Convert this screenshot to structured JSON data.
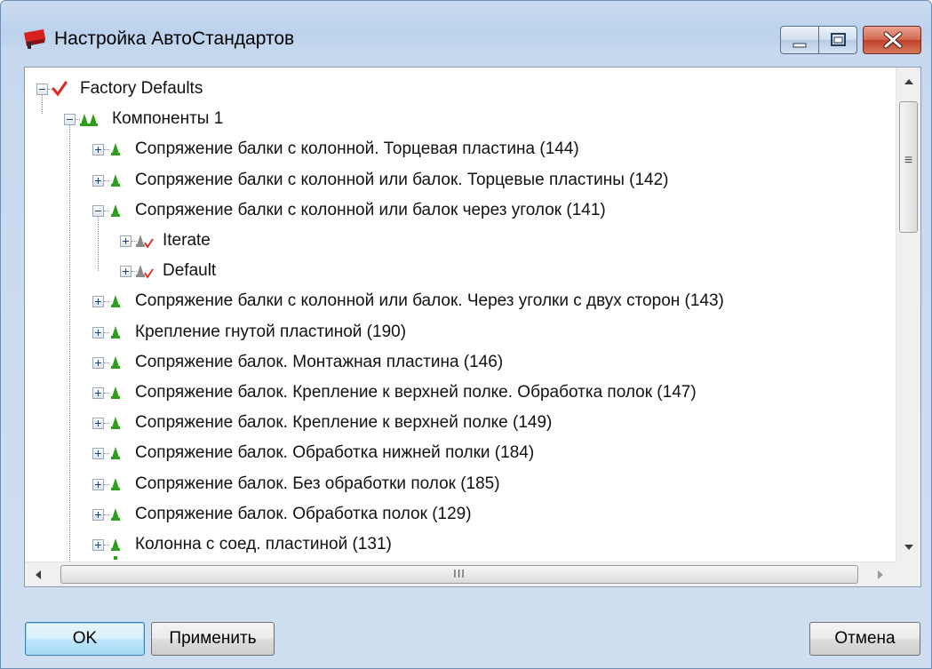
{
  "window": {
    "title": "Настройка АвтоСтандартов"
  },
  "titlebar_buttons": [
    "minimize-button",
    "maximize-button",
    "close-button"
  ],
  "tree": {
    "root": {
      "label": "Factory Defaults",
      "expanded": true
    },
    "group": {
      "label": "Компоненты 1",
      "expanded": true
    },
    "items": [
      {
        "label": "Сопряжение балки с колонной. Торцевая пластина (144)",
        "expanded": false,
        "level": 2
      },
      {
        "label": "Сопряжение балки с колонной или балок. Торцевые пластины (142)",
        "expanded": false,
        "level": 2
      },
      {
        "label": "Сопряжение балки с колонной или балок через уголок (141)",
        "expanded": true,
        "level": 2
      },
      {
        "label": "Iterate",
        "expanded": false,
        "level": 3
      },
      {
        "label": "Default",
        "expanded": false,
        "level": 3
      },
      {
        "label": "Сопряжение балки с колонной или балок. Через уголки с двух сторон (143)",
        "expanded": false,
        "level": 2
      },
      {
        "label": "Крепление гнутой пластиной (190)",
        "expanded": false,
        "level": 2
      },
      {
        "label": "Сопряжение балок. Монтажная пластина (146)",
        "expanded": false,
        "level": 2
      },
      {
        "label": "Сопряжение балок. Крепление к верхней полке. Обработка полок (147)",
        "expanded": false,
        "level": 2
      },
      {
        "label": "Сопряжение балок. Крепление к верхней полке  (149)",
        "expanded": false,
        "level": 2
      },
      {
        "label": "Сопряжение балок. Обработка нижней полки (184)",
        "expanded": false,
        "level": 2
      },
      {
        "label": "Сопряжение балок. Без обработки полок (185)",
        "expanded": false,
        "level": 2
      },
      {
        "label": "Сопряжение балок. Обработка полок (129)",
        "expanded": false,
        "level": 2
      },
      {
        "label": "Колонна с соед. пластиной (131)",
        "expanded": false,
        "level": 2
      }
    ]
  },
  "scrollbars": {
    "vertical_grip": "≡",
    "horizontal_grip": "III"
  },
  "buttons": {
    "ok": "OK",
    "apply": "Применить",
    "cancel": "Отмена"
  },
  "colors": {
    "check_red": "#e0271f",
    "component_green": "#2f9e1a",
    "title_bg": "#c9dbef",
    "close_red": "#c7442e"
  }
}
